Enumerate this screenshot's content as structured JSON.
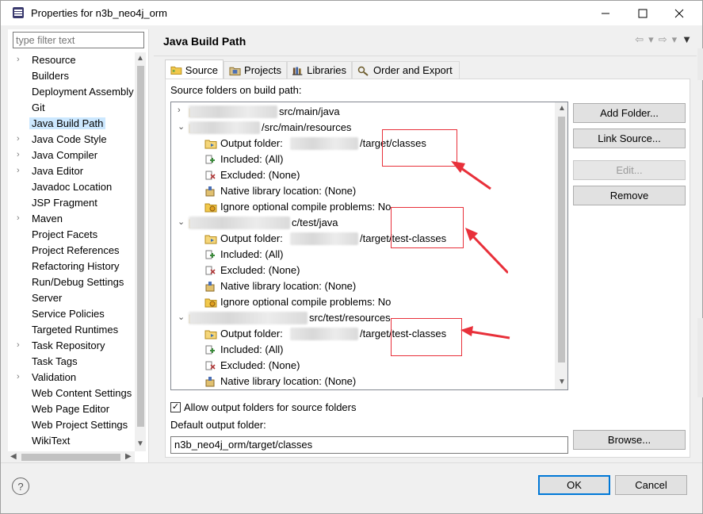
{
  "window": {
    "title": "Properties for n3b_neo4j_orm"
  },
  "filter": {
    "placeholder": "type filter text"
  },
  "sidebar": {
    "items": [
      {
        "label": "Resource",
        "expandable": true
      },
      {
        "label": "Builders",
        "expandable": false
      },
      {
        "label": "Deployment Assembly",
        "expandable": false
      },
      {
        "label": "Git",
        "expandable": false
      },
      {
        "label": "Java Build Path",
        "expandable": false,
        "selected": true
      },
      {
        "label": "Java Code Style",
        "expandable": true
      },
      {
        "label": "Java Compiler",
        "expandable": true
      },
      {
        "label": "Java Editor",
        "expandable": true
      },
      {
        "label": "Javadoc Location",
        "expandable": false
      },
      {
        "label": "JSP Fragment",
        "expandable": false
      },
      {
        "label": "Maven",
        "expandable": true
      },
      {
        "label": "Project Facets",
        "expandable": false
      },
      {
        "label": "Project References",
        "expandable": false
      },
      {
        "label": "Refactoring History",
        "expandable": false
      },
      {
        "label": "Run/Debug Settings",
        "expandable": false
      },
      {
        "label": "Server",
        "expandable": false
      },
      {
        "label": "Service Policies",
        "expandable": false
      },
      {
        "label": "Targeted Runtimes",
        "expandable": false
      },
      {
        "label": "Task Repository",
        "expandable": true
      },
      {
        "label": "Task Tags",
        "expandable": false
      },
      {
        "label": "Validation",
        "expandable": true
      },
      {
        "label": "Web Content Settings",
        "expandable": false
      },
      {
        "label": "Web Page Editor",
        "expandable": false
      },
      {
        "label": "Web Project Settings",
        "expandable": false
      },
      {
        "label": "WikiText",
        "expandable": false
      }
    ]
  },
  "page": {
    "title": "Java Build Path"
  },
  "tabs": [
    {
      "label": "Source",
      "active": true
    },
    {
      "label": "Projects",
      "active": false
    },
    {
      "label": "Libraries",
      "active": false
    },
    {
      "label": "Order and Export",
      "active": false
    }
  ],
  "source": {
    "label": "Source folders on build path:",
    "rows": [
      {
        "kind": "folder",
        "text": "src/main/java",
        "expanded": false
      },
      {
        "kind": "folder",
        "text": "/src/main/resources",
        "expanded": true
      },
      {
        "kind": "output",
        "text": "Output folder:",
        "value": "/target/classes"
      },
      {
        "kind": "included",
        "text": "Included: (All)"
      },
      {
        "kind": "excluded",
        "text": "Excluded: (None)"
      },
      {
        "kind": "native",
        "text": "Native library location: (None)"
      },
      {
        "kind": "ignore",
        "text": "Ignore optional compile problems: No"
      },
      {
        "kind": "folder",
        "text": "c/test/java",
        "expanded": true
      },
      {
        "kind": "output",
        "text": "Output folder:",
        "value": "/target/test-classes"
      },
      {
        "kind": "included",
        "text": "Included: (All)"
      },
      {
        "kind": "excluded",
        "text": "Excluded: (None)"
      },
      {
        "kind": "native",
        "text": "Native library location: (None)"
      },
      {
        "kind": "ignore",
        "text": "Ignore optional compile problems: No"
      },
      {
        "kind": "folder",
        "text": "src/test/resources",
        "expanded": true
      },
      {
        "kind": "output",
        "text": "Output folder:",
        "value": "/target/test-classes"
      },
      {
        "kind": "included",
        "text": "Included: (All)"
      },
      {
        "kind": "excluded",
        "text": "Excluded: (None)"
      },
      {
        "kind": "native",
        "text": "Native library location: (None)"
      }
    ]
  },
  "buttons": {
    "add_folder": "Add Folder...",
    "link_source": "Link Source...",
    "edit": "Edit...",
    "remove": "Remove",
    "browse": "Browse...",
    "ok": "OK",
    "cancel": "Cancel"
  },
  "allow_output": {
    "label": "Allow output folders for source folders",
    "checked": true
  },
  "default_output": {
    "label": "Default output folder:",
    "value": "n3b_neo4j_orm/target/classes"
  },
  "colors": {
    "selection": "#cce8ff",
    "annotation": "#e8303a",
    "primary_border": "#0078d7"
  }
}
